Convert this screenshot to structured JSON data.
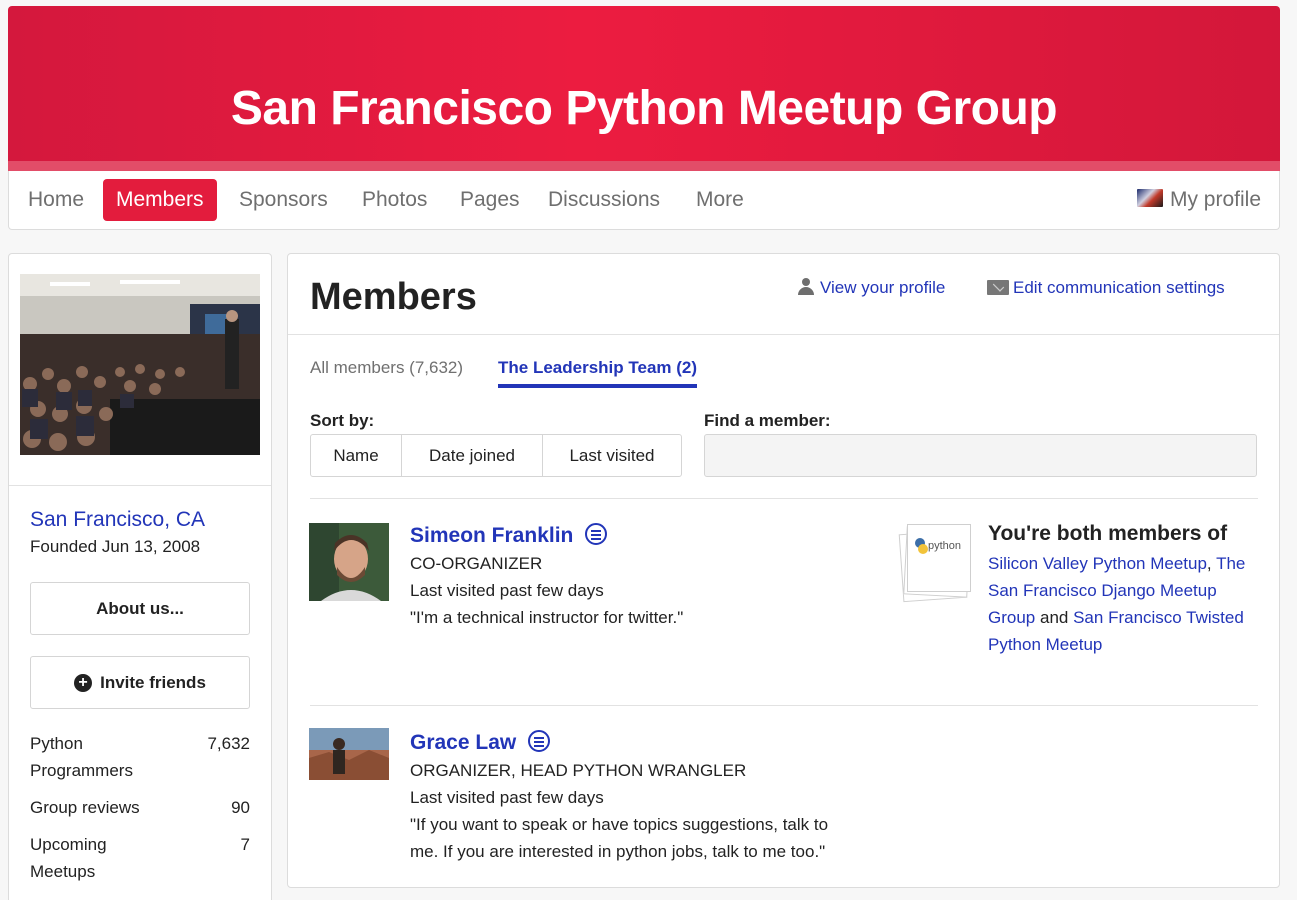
{
  "group": {
    "title": "San Francisco Python Meetup Group",
    "city": "San Francisco, CA",
    "founded": "Founded Jun 13, 2008"
  },
  "nav": {
    "items": [
      "Home",
      "Members",
      "Sponsors",
      "Photos",
      "Pages",
      "Discussions",
      "More"
    ],
    "active": "Members",
    "profile": "My profile"
  },
  "sidebar": {
    "about_btn": "About us...",
    "invite_btn": "Invite friends",
    "stats": [
      {
        "label": "Python Programmers",
        "value": "7,632"
      },
      {
        "label": "Group reviews",
        "value": "90"
      },
      {
        "label": "Upcoming Meetups",
        "value": "7"
      }
    ]
  },
  "members_page": {
    "title": "Members",
    "view_profile": "View your profile",
    "edit_comm": "Edit communication settings",
    "tabs": [
      "All members (7,632)",
      "The Leadership Team (2)"
    ],
    "active_tab": "The Leadership Team (2)",
    "sort_label": "Sort by:",
    "sort_options": [
      "Name",
      "Date joined",
      "Last visited"
    ],
    "find_label": "Find a member:",
    "find_value": ""
  },
  "members": [
    {
      "name": "Simeon Franklin",
      "role": "CO-ORGANIZER",
      "last_visited": "Last visited past few days",
      "bio": "\"I'm a technical instructor for twitter.\""
    },
    {
      "name": "Grace Law",
      "role": "ORGANIZER, HEAD PYTHON WRANGLER",
      "last_visited": "Last visited past few days",
      "bio_line1": "\"If you want to speak or have topics suggestions, talk to",
      "bio_line2": "me. If you are interested in python jobs, talk to me too.\""
    }
  ],
  "shared_groups": {
    "title": "You're both members of",
    "badge_text": "python",
    "groups": [
      "Silicon Valley Python Meetup",
      "The San Francisco Django Meetup Group",
      "San Francisco Twisted Python Meetup"
    ],
    "sep1": ",",
    "and": "and"
  },
  "colors": {
    "brand_red": "#e31c3d",
    "link_blue": "#2235b8"
  }
}
